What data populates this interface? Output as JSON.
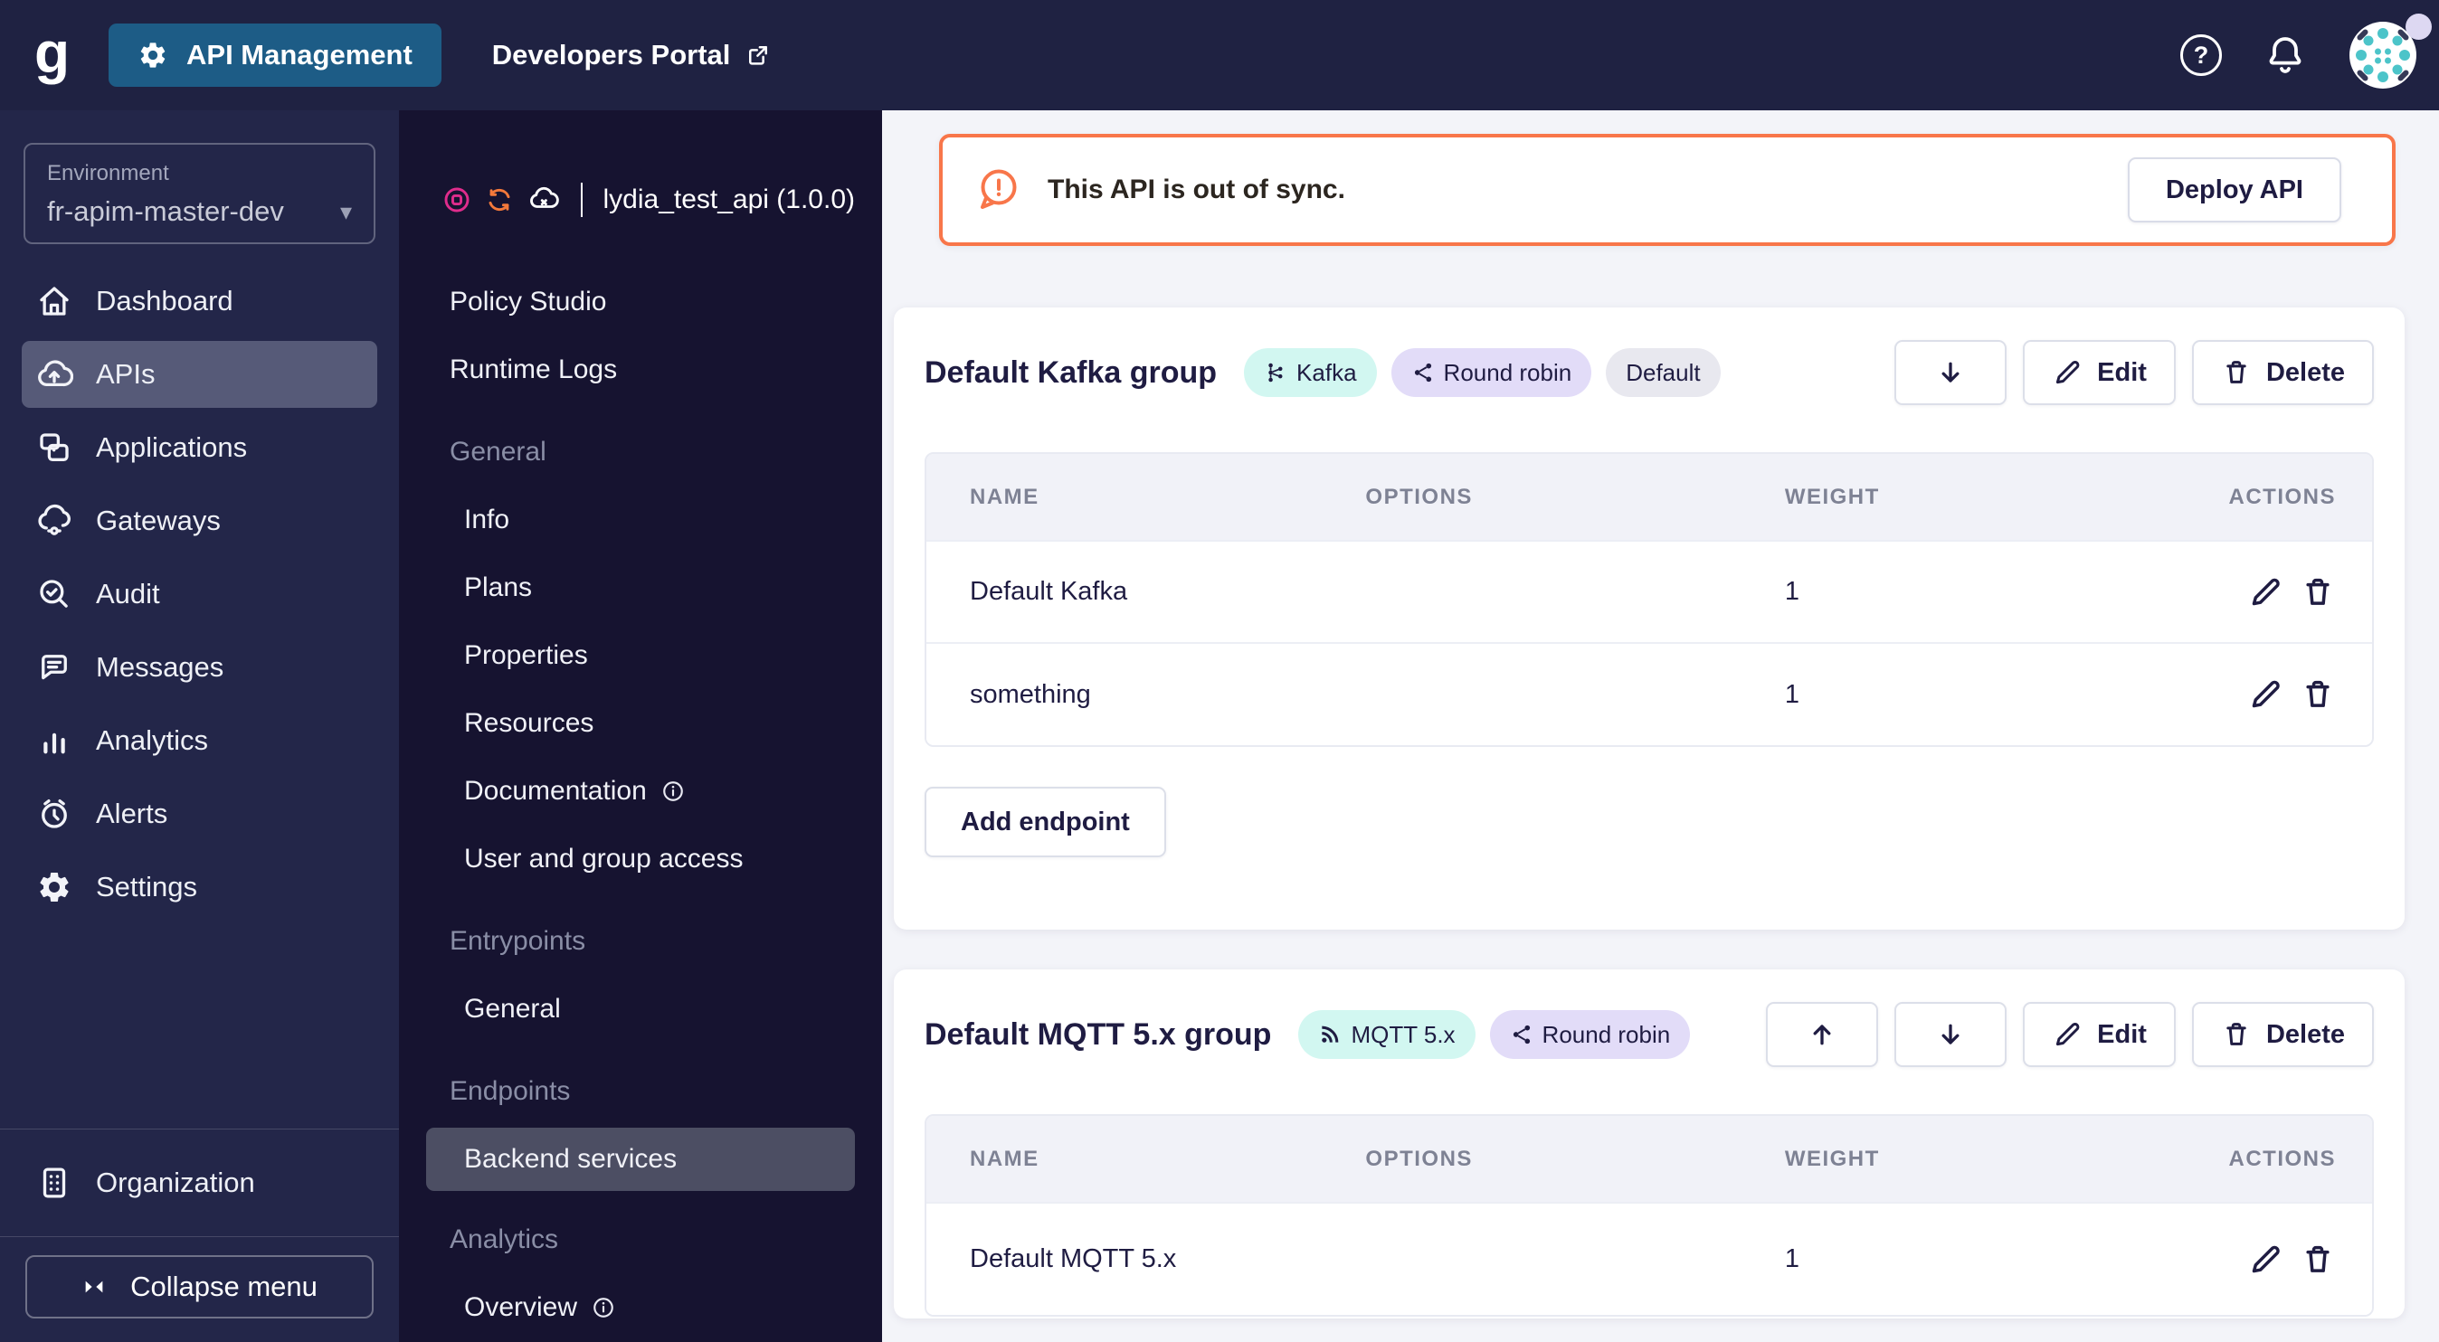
{
  "topbar": {
    "logo_letter": "g",
    "app_button": "API Management",
    "portal_link": "Developers Portal",
    "help_glyph": "?"
  },
  "sidebar": {
    "environment_label": "Environment",
    "environment_value": "fr-apim-master-dev",
    "items": [
      {
        "label": "Dashboard",
        "icon": "home-icon"
      },
      {
        "label": "APIs",
        "icon": "cloud-apis-icon",
        "selected": true
      },
      {
        "label": "Applications",
        "icon": "applications-icon"
      },
      {
        "label": "Gateways",
        "icon": "gateway-cloud-icon"
      },
      {
        "label": "Audit",
        "icon": "audit-search-icon"
      },
      {
        "label": "Messages",
        "icon": "message-bubble-icon"
      },
      {
        "label": "Analytics",
        "icon": "bar-chart-icon"
      },
      {
        "label": "Alerts",
        "icon": "alarm-clock-icon"
      },
      {
        "label": "Settings",
        "icon": "gear-icon"
      }
    ],
    "organization_label": "Organization",
    "collapse_label": "Collapse menu"
  },
  "api_menu": {
    "title": "lydia_test_api (1.0.0)",
    "status_icons": [
      "stop-circle-icon",
      "sync-icon",
      "cloud-not-deployed-icon"
    ],
    "items": [
      {
        "label": "Policy Studio"
      },
      {
        "label": "Runtime Logs"
      }
    ],
    "sections": [
      {
        "header": "General",
        "items": [
          {
            "label": "Info"
          },
          {
            "label": "Plans"
          },
          {
            "label": "Properties"
          },
          {
            "label": "Resources"
          },
          {
            "label": "Documentation",
            "info": true
          },
          {
            "label": "User and group access"
          }
        ]
      },
      {
        "header": "Entrypoints",
        "items": [
          {
            "label": "General"
          }
        ]
      },
      {
        "header": "Endpoints",
        "items": [
          {
            "label": "Backend services",
            "selected": true
          }
        ]
      },
      {
        "header": "Analytics",
        "items": [
          {
            "label": "Overview",
            "info": true
          }
        ]
      }
    ]
  },
  "main": {
    "banner": {
      "message": "This API is out of sync.",
      "action_label": "Deploy API"
    },
    "groups": [
      {
        "title": "Default Kafka group",
        "badges": [
          {
            "label": "Kafka",
            "style": "teal",
            "icon": "kafka-icon"
          },
          {
            "label": "Round robin",
            "style": "purple",
            "icon": "share-icon"
          },
          {
            "label": "Default",
            "style": "gray",
            "icon": ""
          }
        ],
        "edit_label": "Edit",
        "delete_label": "Delete",
        "columns": {
          "name": "NAME",
          "options": "OPTIONS",
          "weight": "WEIGHT",
          "actions": "ACTIONS"
        },
        "rows": [
          {
            "name": "Default Kafka",
            "options": "",
            "weight": "1"
          },
          {
            "name": "something",
            "options": "",
            "weight": "1"
          }
        ],
        "add_label": "Add endpoint"
      },
      {
        "title": "Default MQTT 5.x group",
        "badges": [
          {
            "label": "MQTT 5.x",
            "style": "teal",
            "icon": "mqtt-icon"
          },
          {
            "label": "Round robin",
            "style": "purple",
            "icon": "share-icon"
          }
        ],
        "edit_label": "Edit",
        "delete_label": "Delete",
        "columns": {
          "name": "NAME",
          "options": "OPTIONS",
          "weight": "WEIGHT",
          "actions": "ACTIONS"
        },
        "rows": [
          {
            "name": "Default MQTT 5.x",
            "options": "",
            "weight": "1"
          }
        ]
      }
    ]
  },
  "colors": {
    "topbar_bg": "#1f2242",
    "sidebar_bg": "#232649",
    "api_sidebar_bg": "#161330",
    "selected_item_bg": "#565a78",
    "accent_blue": "#1d5c86",
    "warning_orange": "#f8764a",
    "status_pink": "#e02c8c",
    "status_sync_orange": "#f4793b",
    "badge_teal_bg": "#d2f7f1",
    "badge_purple_bg": "#e2dcf8",
    "badge_gray_bg": "#e8e8ef",
    "main_bg": "#f3f4f9",
    "text_navy": "#1f1c42",
    "avatar_teal": "#4cc4c9"
  }
}
